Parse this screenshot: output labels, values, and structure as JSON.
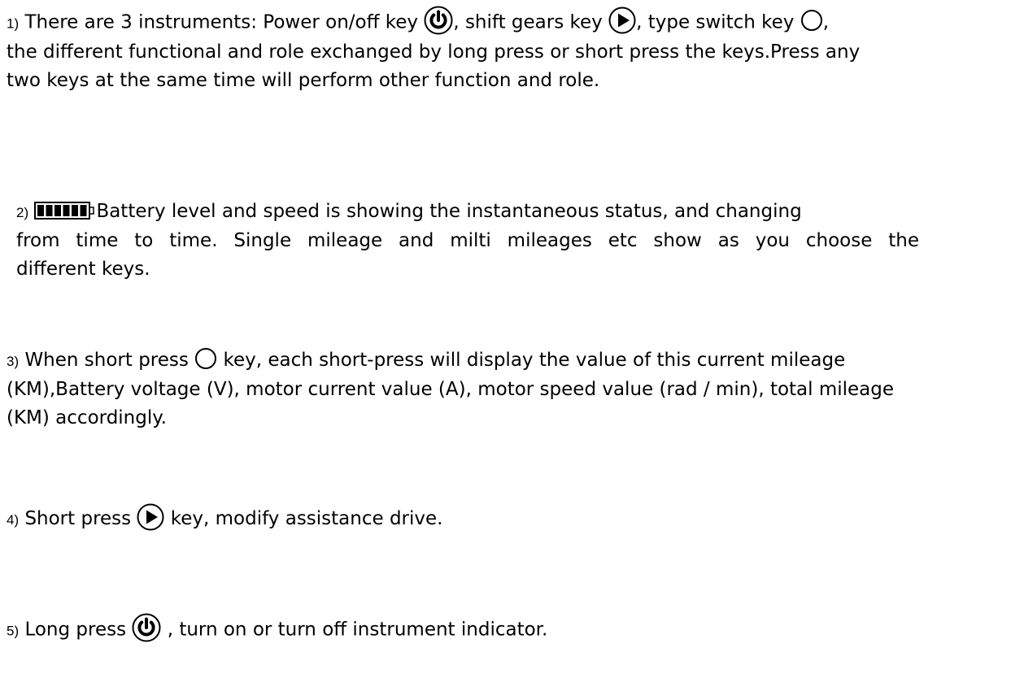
{
  "document": {
    "items": [
      {
        "number": "1)",
        "lines": [
          [
            "There are 3 instruments: Power on/off key ",
            ", shift gears key ",
            ", type switch key ",
            ","
          ],
          "the different functional and role exchanged by long press or short press the keys.Press any",
          "two keys at the same time will perform other function and role."
        ]
      },
      {
        "number": "2)",
        "lines": [
          "Battery level and speed is showing the instantaneous status, and changing",
          "from time to time. Single mileage and milti mileages etc show as you choose the",
          "different keys."
        ]
      },
      {
        "number": "3)",
        "lines": [
          [
            "When short press ",
            " key, each short-press will display the value of this current mileage"
          ],
          "(KM),Battery voltage (V), motor current value (A), motor speed value (rad / min), total mileage",
          "(KM) accordingly."
        ]
      },
      {
        "number": "4)",
        "lines": [
          [
            "Short press ",
            " key, modify assistance drive."
          ]
        ]
      },
      {
        "number": "5)",
        "lines": [
          [
            "Long press ",
            " , turn on or turn off instrument indicator."
          ]
        ]
      }
    ],
    "icons": {
      "power": "power-icon",
      "shift": "play-arrow-icon",
      "switch": "circle-outline-icon",
      "battery": "battery-full-icon"
    }
  }
}
